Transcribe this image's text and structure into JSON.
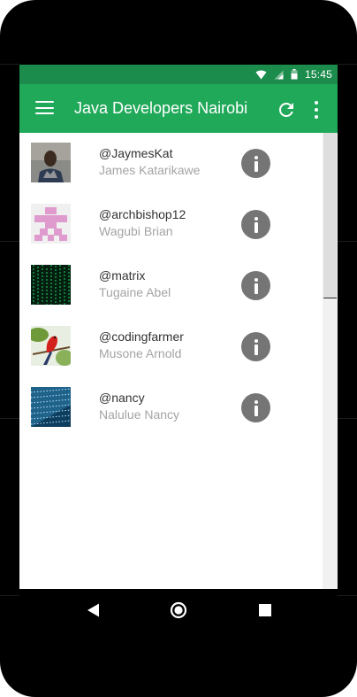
{
  "status_bar": {
    "time": "15:45",
    "icons": [
      "wifi-icon",
      "signal-icon",
      "battery-icon"
    ],
    "background": "#1c8c4c"
  },
  "app_bar": {
    "title": "Java Developers Nairobi",
    "menu_icon": "hamburger-menu-icon",
    "actions": [
      "refresh-icon",
      "overflow-menu-icon"
    ],
    "background": "#21a95a"
  },
  "developers": [
    {
      "username": "@JaymesKat",
      "name": "James Katarikawe",
      "avatar": "profile-photo"
    },
    {
      "username": "@archbishop12",
      "name": "Wagubi Brian",
      "avatar": "pink-identicon"
    },
    {
      "username": "@matrix",
      "name": "Tugaine Abel",
      "avatar": "matrix-code"
    },
    {
      "username": "@codingfarmer",
      "name": "Musone Arnold",
      "avatar": "red-bird-photo"
    },
    {
      "username": "@nancy",
      "name": "Nalulue Nancy",
      "avatar": "binary-code"
    }
  ],
  "nav_bar": {
    "buttons": [
      "back-icon",
      "home-icon",
      "recents-icon"
    ]
  }
}
